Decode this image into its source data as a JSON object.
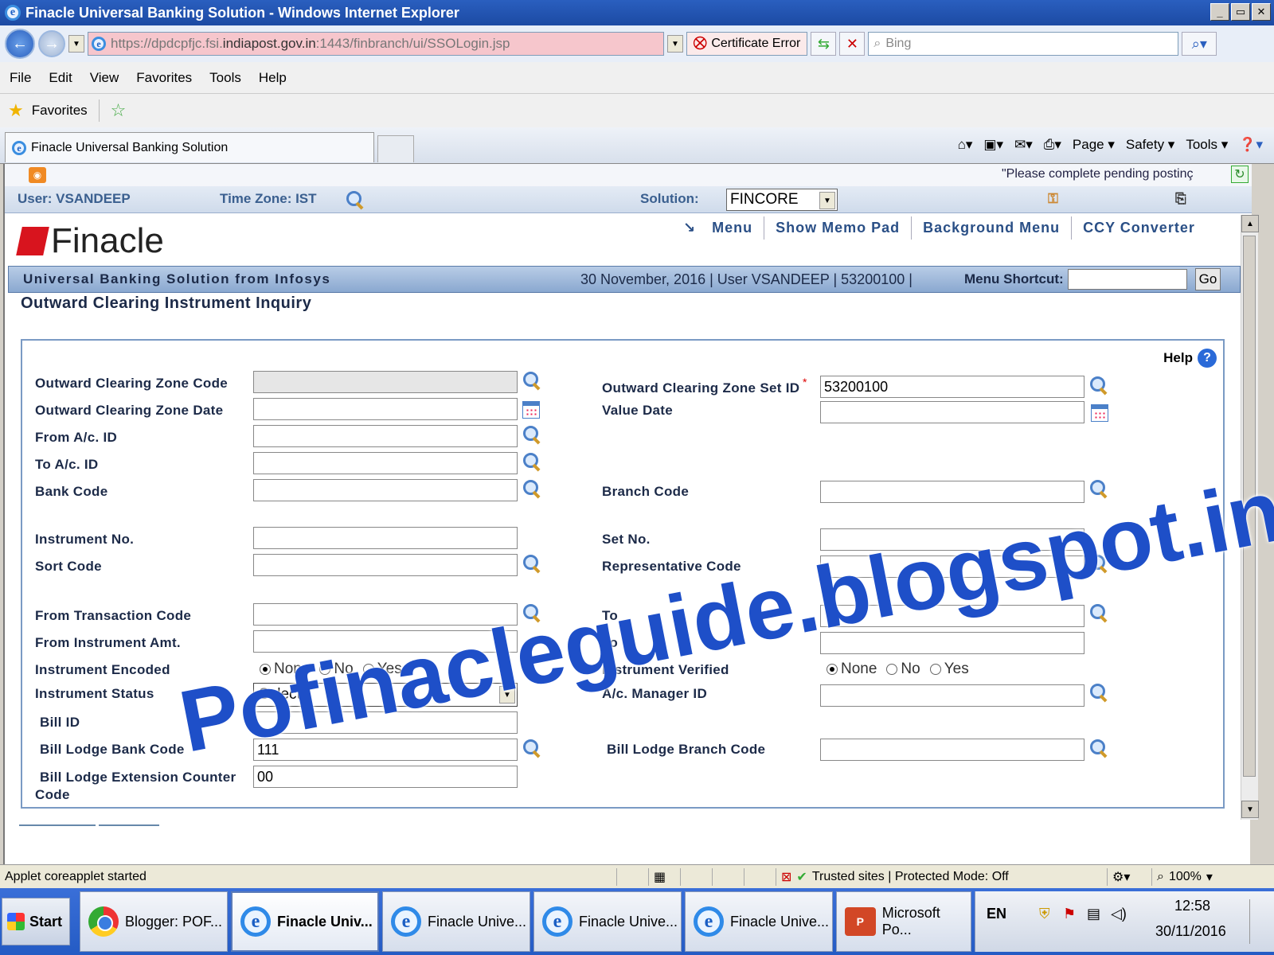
{
  "window": {
    "title": "Finacle Universal Banking Solution - Windows Internet Explorer",
    "controls": [
      "_",
      "▭",
      "✕"
    ]
  },
  "browser": {
    "url_prefix": "https://dpdcpfjc.fsi.",
    "url_domain": "indiapost.gov.in",
    "url_suffix": ":1443/finbranch/ui/SSOLogin.jsp",
    "cert_error": "Certificate Error",
    "search_placeholder": "Bing",
    "menu": [
      "File",
      "Edit",
      "View",
      "Favorites",
      "Tools",
      "Help"
    ],
    "favorites_label": "Favorites",
    "tab_title": "Finacle Universal Banking Solution",
    "command_bar": [
      "Page ▾",
      "Safety ▾",
      "Tools ▾"
    ]
  },
  "app": {
    "pending_msg": "\"Please complete pending postinç",
    "user_label": "User: VSANDEEP",
    "timezone_label": "Time Zone:  IST",
    "solution_label": "Solution:",
    "solution_value": "FINCORE",
    "logo_text": "Finacle",
    "top_nav": [
      "Menu",
      "Show Memo Pad",
      "Background Menu",
      "CCY Converter"
    ],
    "banner_title": "Universal Banking Solution from Infosys",
    "banner_info": "30 November, 2016  |  User  VSANDEEP  |  53200100  |",
    "menu_shortcut_label": "Menu Shortcut:",
    "go_label": "Go",
    "page_title": "Outward Clearing Instrument Inquiry",
    "help_label": "Help",
    "watermark": "Pofinacleguide.blogspot.in"
  },
  "form": {
    "left": [
      {
        "label": "Outward Clearing Zone Code",
        "value": ""
      },
      {
        "label": "Outward Clearing Zone Date",
        "value": ""
      },
      {
        "label": "From A/c. ID",
        "value": ""
      },
      {
        "label": "To A/c. ID",
        "value": ""
      },
      {
        "label": "Bank Code",
        "value": ""
      },
      {
        "label": "Instrument No.",
        "value": ""
      },
      {
        "label": "Sort Code",
        "value": ""
      },
      {
        "label": "From Transaction Code",
        "value": ""
      },
      {
        "label": "From Instrument Amt.",
        "value": ""
      },
      {
        "label": "Instrument Encoded",
        "value": ""
      },
      {
        "label": "Instrument Status",
        "value": "Select"
      },
      {
        "label": "Bill ID",
        "value": ""
      },
      {
        "label": "Bill Lodge Bank Code",
        "value": "111"
      },
      {
        "label": "Bill Lodge Extension Counter Code",
        "value": "00"
      }
    ],
    "right": [
      {
        "label": "Outward Clearing Zone Set ID",
        "value": "53200100",
        "required": "*"
      },
      {
        "label": "Value Date",
        "value": ""
      },
      {
        "label": "Branch Code",
        "value": ""
      },
      {
        "label": "Set No.",
        "value": ""
      },
      {
        "label": "Representative Code",
        "value": ""
      },
      {
        "label": "To",
        "value": ""
      },
      {
        "label": "To",
        "value": ""
      },
      {
        "label": "Instrument Verified",
        "value": ""
      },
      {
        "label": "A/c. Manager ID",
        "value": ""
      },
      {
        "label": "Bill Lodge Branch Code",
        "value": ""
      }
    ],
    "radio_options": [
      "None",
      "No",
      "Yes"
    ],
    "radio_selected": "None"
  },
  "status": {
    "message": "Applet coreapplet started",
    "zone": "Trusted sites | Protected Mode: Off",
    "zoom": "100%"
  },
  "taskbar": {
    "start": "Start",
    "tasks": [
      "Blogger: POF...",
      "Finacle Univ...",
      "Finacle Unive...",
      "Finacle Unive...",
      "Finacle Unive...",
      "Microsoft Po..."
    ],
    "lang": "EN",
    "time": "12:58",
    "date": "30/11/2016"
  }
}
